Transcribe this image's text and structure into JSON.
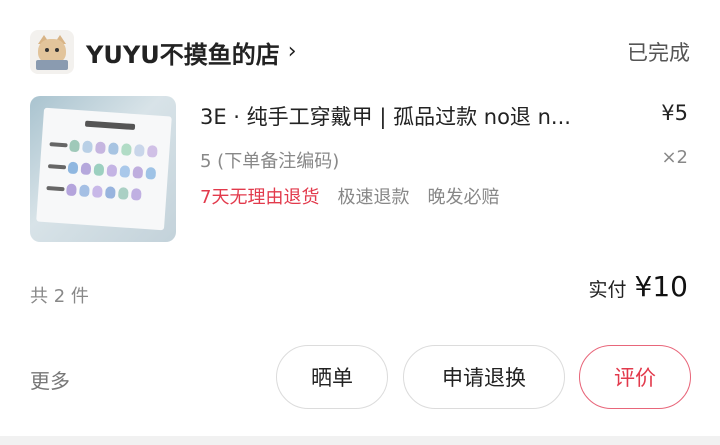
{
  "shop": {
    "name": "YUYU不摸鱼的店",
    "chevron": "›",
    "status": "已完成"
  },
  "product": {
    "title": "3E · 纯手工穿戴甲 | 孤品过款 no退 n...",
    "price": "¥5",
    "spec": "5 (下单备注编码)",
    "quantity": "×2",
    "tags": [
      "7天无理由退货",
      "极速退款",
      "晚发必赔"
    ]
  },
  "summary": {
    "item_count": "共 2 件",
    "paid_label": "实付",
    "paid_amount": "¥10"
  },
  "actions": {
    "more": "更多",
    "share": "晒单",
    "refund": "申请退换",
    "review": "评价"
  },
  "colors": {
    "accent_red": "#e23a4c",
    "review_border": "#e8667a",
    "muted_text": "#888888"
  },
  "icons": {
    "shop_avatar": "cat-avatar-icon",
    "chevron": "chevron-right-icon"
  }
}
